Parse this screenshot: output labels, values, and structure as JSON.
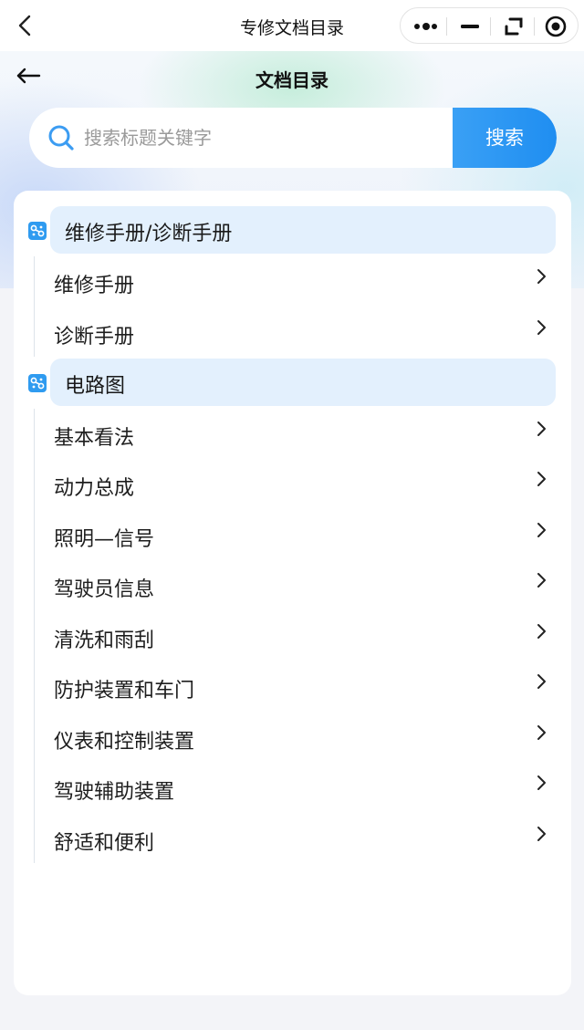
{
  "window": {
    "title": "专修文档目录"
  },
  "header": {
    "title": "文档目录"
  },
  "search": {
    "placeholder": "搜索标题关键字",
    "value": "",
    "button_label": "搜索"
  },
  "groups": [
    {
      "label": "维修手册/诊断手册",
      "items": [
        "维修手册",
        "诊断手册"
      ]
    },
    {
      "label": "电路图",
      "items": [
        "基本看法",
        "动力总成",
        "照明—信号",
        "驾驶员信息",
        "清洗和雨刮",
        "防护装置和车门",
        "仪表和控制装置",
        "驾驶辅助装置",
        "舒适和便利"
      ]
    }
  ],
  "colors": {
    "accent": "#1f8ef1",
    "group_bg": "#e3f0fd",
    "card_bg": "#ffffff",
    "page_bg": "#f3f4f8"
  },
  "icons": {
    "back": "chevron-left-icon",
    "more": "more-dots-icon",
    "minimize": "minus-icon",
    "restore": "restore-icon",
    "close": "record-circle-icon",
    "page_back": "arrow-left-icon",
    "search": "search-icon",
    "group": "link-icon",
    "item": "chevron-right-icon"
  }
}
